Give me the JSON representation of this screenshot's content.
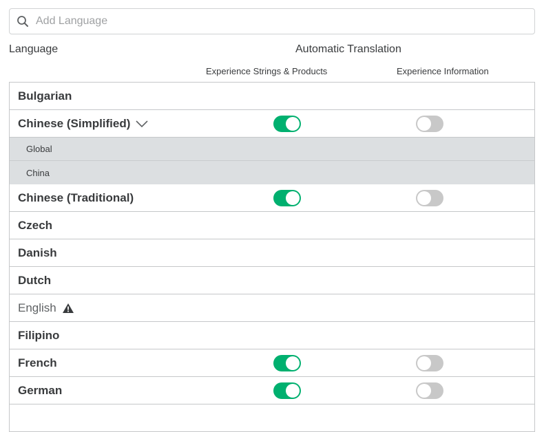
{
  "search": {
    "placeholder": "Add Language",
    "value": ""
  },
  "headers": {
    "language": "Language",
    "automatic_translation": "Automatic Translation",
    "col_strings": "Experience Strings & Products",
    "col_info": "Experience Information"
  },
  "rows": [
    {
      "name": "Bulgarian"
    },
    {
      "name": "Chinese (Simplified)",
      "expanded": true,
      "strings": true,
      "info": false
    },
    {
      "sub": "Global"
    },
    {
      "sub": "China"
    },
    {
      "name": "Chinese (Traditional)",
      "strings": true,
      "info": false
    },
    {
      "name": "Czech"
    },
    {
      "name": "Danish"
    },
    {
      "name": "Dutch"
    },
    {
      "name": "English",
      "warning": true
    },
    {
      "name": "Filipino"
    },
    {
      "name": "French",
      "strings": true,
      "info": false
    },
    {
      "name": "German",
      "strings": true,
      "info": false
    }
  ],
  "colors": {
    "toggle_on": "#00b06f",
    "toggle_off": "#c8c8c8",
    "subrow_bg": "#dcdfe1"
  },
  "icons": {
    "search": "search-icon",
    "chevron": "chevron-down-icon",
    "warning": "warning-icon"
  }
}
